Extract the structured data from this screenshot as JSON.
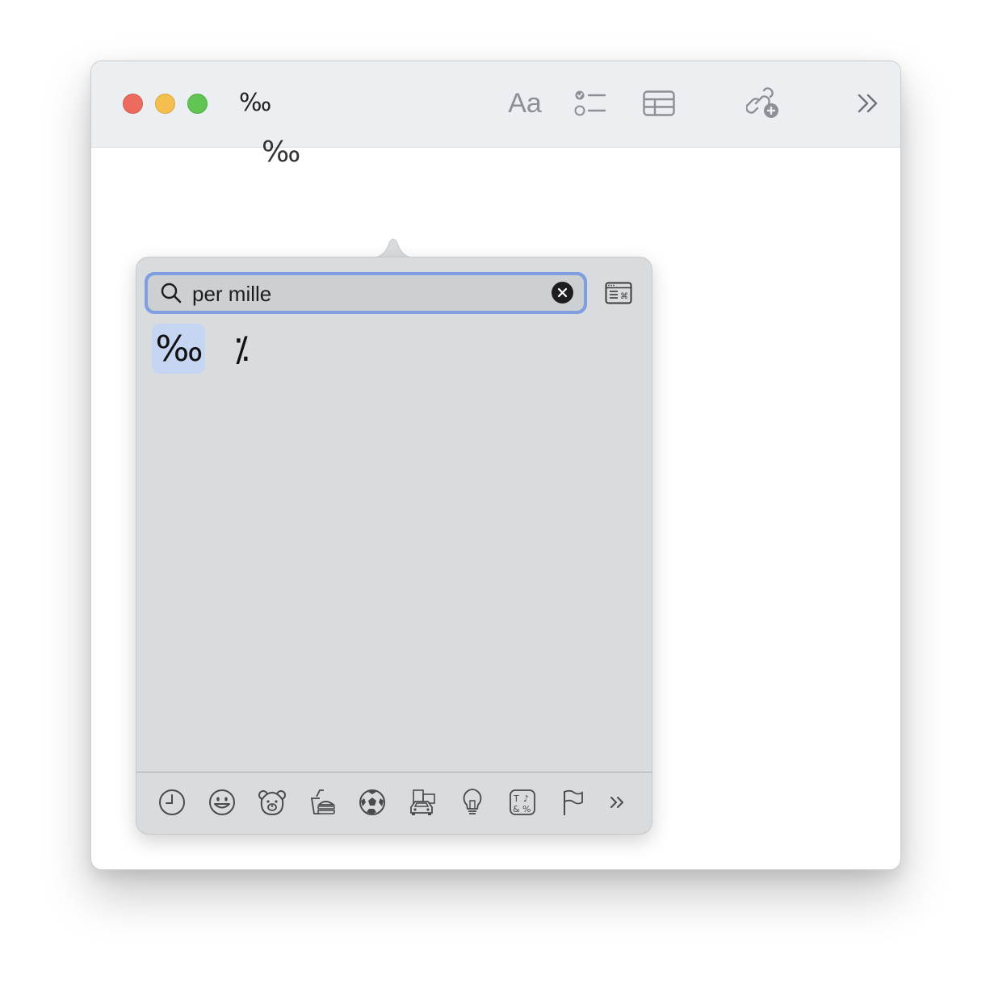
{
  "window": {
    "title": "‰",
    "toolbar": {
      "format_label": "Aa",
      "icons": [
        "format-icon",
        "checklist-icon",
        "table-icon",
        "collaborate-icon",
        "more-icon"
      ]
    }
  },
  "document": {
    "content": "‰"
  },
  "character_viewer": {
    "search": {
      "value": "per mille",
      "icon": "search-icon",
      "clear_icon": "clear-icon"
    },
    "expand_icon": "character-viewer-icon",
    "results": [
      "‰",
      "⁒"
    ],
    "categories": [
      "recent-icon",
      "smileys-icon",
      "animals-icon",
      "food-icon",
      "activity-icon",
      "travel-icon",
      "objects-icon",
      "symbols-icon",
      "flags-icon",
      "more-categories-icon"
    ],
    "accent_color": "#7f9fe0",
    "selected_color": "#c6d5f2"
  }
}
